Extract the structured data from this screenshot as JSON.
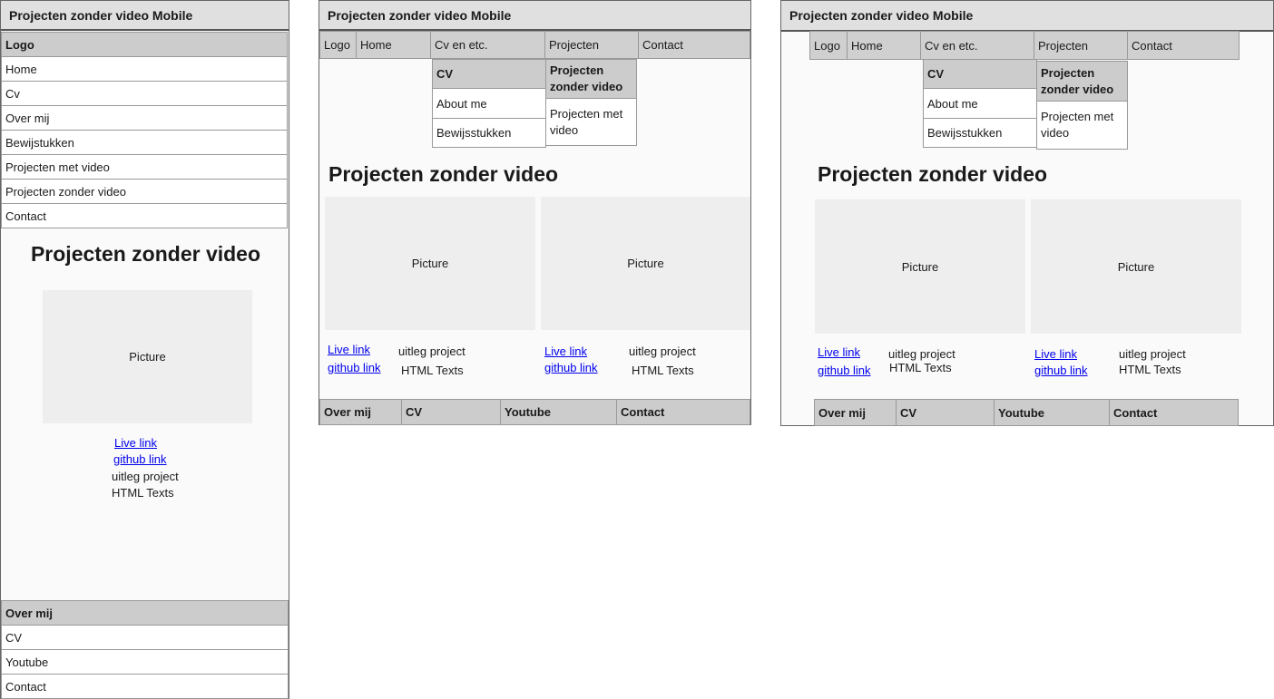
{
  "mobile": {
    "title": "Projecten zonder video Mobile",
    "menu": [
      "Logo",
      "Home",
      "Cv",
      "Over mij",
      "Bewijstukken",
      "Projecten met video",
      "Projecten zonder video",
      "Contact"
    ],
    "heading": "Projecten zonder video",
    "picture": "Picture",
    "live_link": "Live link",
    "github_link": "github link",
    "text1": "uitleg project",
    "text2": "HTML Texts",
    "footer": [
      "Over mij",
      "CV",
      "Youtube",
      "Contact"
    ]
  },
  "tablet": {
    "title": "Projecten zonder video Mobile",
    "nav": [
      "Logo",
      "Home",
      "Cv en etc.",
      "Projecten",
      "Contact"
    ],
    "cv_dropdown": [
      "CV",
      "About me",
      "Bewijsstukken"
    ],
    "projecten_dropdown": [
      "Projecten zonder video",
      "Projecten met video"
    ],
    "heading": "Projecten zonder video",
    "picture": "Picture",
    "live_link": "Live link",
    "github_link": "github link",
    "text1": "uitleg project",
    "text2": "HTML Texts",
    "footer": [
      "Over mij",
      "CV",
      "Youtube",
      "Contact"
    ]
  },
  "desktop": {
    "title": "Projecten zonder video Mobile",
    "nav": [
      "Logo",
      "Home",
      "Cv en etc.",
      "Projecten",
      "Contact"
    ],
    "cv_dropdown": [
      "CV",
      "About me",
      "Bewijsstukken"
    ],
    "projecten_dropdown": [
      "Projecten zonder video",
      "Projecten met video"
    ],
    "heading": "Projecten zonder video",
    "picture": "Picture",
    "live_link": "Live link",
    "github_link": "github link",
    "text1": "uitleg project",
    "text2": "HTML Texts",
    "footer": [
      "Over mij",
      "CV",
      "Youtube",
      "Contact"
    ]
  }
}
